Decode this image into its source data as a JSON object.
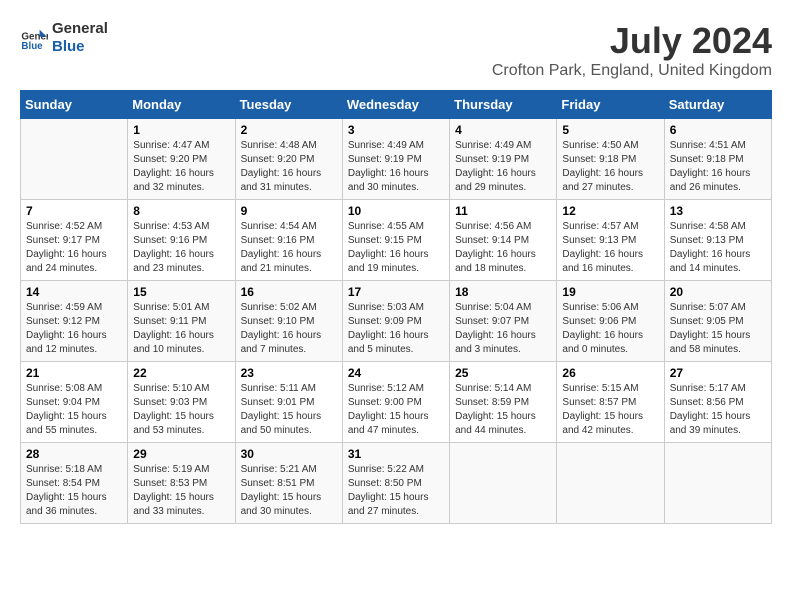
{
  "header": {
    "logo_line1": "General",
    "logo_line2": "Blue",
    "title": "July 2024",
    "subtitle": "Crofton Park, England, United Kingdom"
  },
  "columns": [
    "Sunday",
    "Monday",
    "Tuesday",
    "Wednesday",
    "Thursday",
    "Friday",
    "Saturday"
  ],
  "rows": [
    [
      {
        "day": "",
        "info": ""
      },
      {
        "day": "1",
        "info": "Sunrise: 4:47 AM\nSunset: 9:20 PM\nDaylight: 16 hours\nand 32 minutes."
      },
      {
        "day": "2",
        "info": "Sunrise: 4:48 AM\nSunset: 9:20 PM\nDaylight: 16 hours\nand 31 minutes."
      },
      {
        "day": "3",
        "info": "Sunrise: 4:49 AM\nSunset: 9:19 PM\nDaylight: 16 hours\nand 30 minutes."
      },
      {
        "day": "4",
        "info": "Sunrise: 4:49 AM\nSunset: 9:19 PM\nDaylight: 16 hours\nand 29 minutes."
      },
      {
        "day": "5",
        "info": "Sunrise: 4:50 AM\nSunset: 9:18 PM\nDaylight: 16 hours\nand 27 minutes."
      },
      {
        "day": "6",
        "info": "Sunrise: 4:51 AM\nSunset: 9:18 PM\nDaylight: 16 hours\nand 26 minutes."
      }
    ],
    [
      {
        "day": "7",
        "info": "Sunrise: 4:52 AM\nSunset: 9:17 PM\nDaylight: 16 hours\nand 24 minutes."
      },
      {
        "day": "8",
        "info": "Sunrise: 4:53 AM\nSunset: 9:16 PM\nDaylight: 16 hours\nand 23 minutes."
      },
      {
        "day": "9",
        "info": "Sunrise: 4:54 AM\nSunset: 9:16 PM\nDaylight: 16 hours\nand 21 minutes."
      },
      {
        "day": "10",
        "info": "Sunrise: 4:55 AM\nSunset: 9:15 PM\nDaylight: 16 hours\nand 19 minutes."
      },
      {
        "day": "11",
        "info": "Sunrise: 4:56 AM\nSunset: 9:14 PM\nDaylight: 16 hours\nand 18 minutes."
      },
      {
        "day": "12",
        "info": "Sunrise: 4:57 AM\nSunset: 9:13 PM\nDaylight: 16 hours\nand 16 minutes."
      },
      {
        "day": "13",
        "info": "Sunrise: 4:58 AM\nSunset: 9:13 PM\nDaylight: 16 hours\nand 14 minutes."
      }
    ],
    [
      {
        "day": "14",
        "info": "Sunrise: 4:59 AM\nSunset: 9:12 PM\nDaylight: 16 hours\nand 12 minutes."
      },
      {
        "day": "15",
        "info": "Sunrise: 5:01 AM\nSunset: 9:11 PM\nDaylight: 16 hours\nand 10 minutes."
      },
      {
        "day": "16",
        "info": "Sunrise: 5:02 AM\nSunset: 9:10 PM\nDaylight: 16 hours\nand 7 minutes."
      },
      {
        "day": "17",
        "info": "Sunrise: 5:03 AM\nSunset: 9:09 PM\nDaylight: 16 hours\nand 5 minutes."
      },
      {
        "day": "18",
        "info": "Sunrise: 5:04 AM\nSunset: 9:07 PM\nDaylight: 16 hours\nand 3 minutes."
      },
      {
        "day": "19",
        "info": "Sunrise: 5:06 AM\nSunset: 9:06 PM\nDaylight: 16 hours\nand 0 minutes."
      },
      {
        "day": "20",
        "info": "Sunrise: 5:07 AM\nSunset: 9:05 PM\nDaylight: 15 hours\nand 58 minutes."
      }
    ],
    [
      {
        "day": "21",
        "info": "Sunrise: 5:08 AM\nSunset: 9:04 PM\nDaylight: 15 hours\nand 55 minutes."
      },
      {
        "day": "22",
        "info": "Sunrise: 5:10 AM\nSunset: 9:03 PM\nDaylight: 15 hours\nand 53 minutes."
      },
      {
        "day": "23",
        "info": "Sunrise: 5:11 AM\nSunset: 9:01 PM\nDaylight: 15 hours\nand 50 minutes."
      },
      {
        "day": "24",
        "info": "Sunrise: 5:12 AM\nSunset: 9:00 PM\nDaylight: 15 hours\nand 47 minutes."
      },
      {
        "day": "25",
        "info": "Sunrise: 5:14 AM\nSunset: 8:59 PM\nDaylight: 15 hours\nand 44 minutes."
      },
      {
        "day": "26",
        "info": "Sunrise: 5:15 AM\nSunset: 8:57 PM\nDaylight: 15 hours\nand 42 minutes."
      },
      {
        "day": "27",
        "info": "Sunrise: 5:17 AM\nSunset: 8:56 PM\nDaylight: 15 hours\nand 39 minutes."
      }
    ],
    [
      {
        "day": "28",
        "info": "Sunrise: 5:18 AM\nSunset: 8:54 PM\nDaylight: 15 hours\nand 36 minutes."
      },
      {
        "day": "29",
        "info": "Sunrise: 5:19 AM\nSunset: 8:53 PM\nDaylight: 15 hours\nand 33 minutes."
      },
      {
        "day": "30",
        "info": "Sunrise: 5:21 AM\nSunset: 8:51 PM\nDaylight: 15 hours\nand 30 minutes."
      },
      {
        "day": "31",
        "info": "Sunrise: 5:22 AM\nSunset: 8:50 PM\nDaylight: 15 hours\nand 27 minutes."
      },
      {
        "day": "",
        "info": ""
      },
      {
        "day": "",
        "info": ""
      },
      {
        "day": "",
        "info": ""
      }
    ]
  ]
}
